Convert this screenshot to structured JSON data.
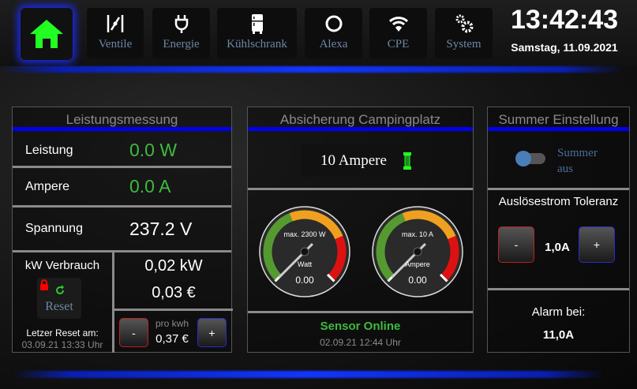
{
  "nav": {
    "home_icon": "home-icon",
    "items": [
      {
        "label": "Ventile",
        "icon": "valve-icon"
      },
      {
        "label": "Energie",
        "icon": "plug-icon"
      },
      {
        "label": "Kühlschrank",
        "icon": "fridge-icon"
      },
      {
        "label": "Alexa",
        "icon": "alexa-ring-icon"
      },
      {
        "label": "CPE",
        "icon": "wifi-icon"
      },
      {
        "label": "System",
        "icon": "gears-icon"
      }
    ]
  },
  "clock": {
    "time": "13:42:43",
    "date": "Samstag, 11.09.2021"
  },
  "power": {
    "title": "Leistungsmessung",
    "rows": [
      {
        "label": "Leistung",
        "value": "0.0 W"
      },
      {
        "label": "Ampere",
        "value": "0.0 A"
      },
      {
        "label": "Spannung",
        "value": "237.2 V"
      }
    ],
    "consumption": {
      "label": "kW Verbrauch",
      "reset_label": "Reset",
      "last_reset_label": "Letzer Reset am:",
      "last_reset": "03.09.21 13:33 Uhr",
      "kw": "0,02 kW",
      "cost": "0,03 €",
      "price_label": "pro kwh",
      "price": "0,37 €",
      "minus": "-",
      "plus": "+"
    }
  },
  "fuse": {
    "title": "Absicherung Campingplatz",
    "selected": "10 Ampere",
    "gauges": [
      {
        "max_label": "max. 2300 W",
        "unit": "Watt",
        "value": "0.00",
        "fraction": 0
      },
      {
        "max_label": "max. 10 A",
        "unit": "Ampere",
        "value": "0.00",
        "fraction": 0
      }
    ],
    "status": "Sensor Online",
    "status_time": "02.09.21 12:44 Uhr"
  },
  "buzzer": {
    "title": "Summer Einstellung",
    "toggle_label": "Summer aus",
    "toggle_on": false,
    "tolerance_label": "Auslösestrom Toleranz",
    "tolerance": "1,0A",
    "minus": "-",
    "plus": "+",
    "alarm_label": "Alarm bei:",
    "alarm": "11,0A"
  },
  "colors": {
    "accent": "#0000ee",
    "ok": "#3dbb3d",
    "home": "#22ff22"
  }
}
